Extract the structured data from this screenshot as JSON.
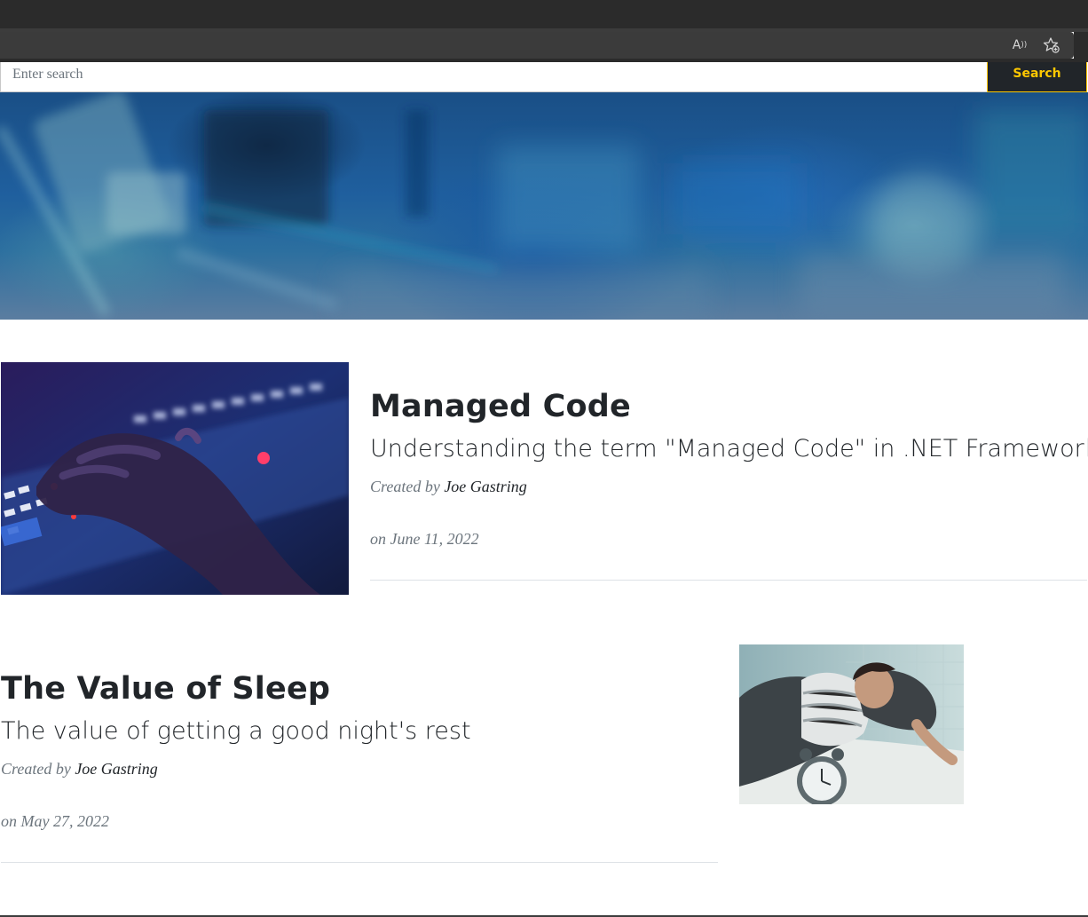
{
  "browser": {
    "read_aloud_icon": "read-aloud-icon",
    "favorites_icon": "add-favorite-icon"
  },
  "search": {
    "placeholder": "Enter search",
    "button_label": "Search"
  },
  "hero": {
    "image": "blurred-circuit-board-hero"
  },
  "posts": [
    {
      "title": "Managed Code",
      "subtitle": "Understanding the term \"Managed Code\" in .NET Framework",
      "created_by_label": "Created by",
      "author": "Joe Gastring",
      "date": "on June 11, 2022",
      "image": "hand-on-backlit-keyboard"
    },
    {
      "title": "The Value of Sleep",
      "subtitle": "The value of getting a good night's rest",
      "created_by_label": "Created by",
      "author": "Joe Gastring",
      "date": "on May 27, 2022",
      "image": "woman-lying-in-bed-with-alarm-clock"
    }
  ],
  "colors": {
    "accent": "#ffc800",
    "dark": "#212529",
    "muted": "#6c757d"
  }
}
